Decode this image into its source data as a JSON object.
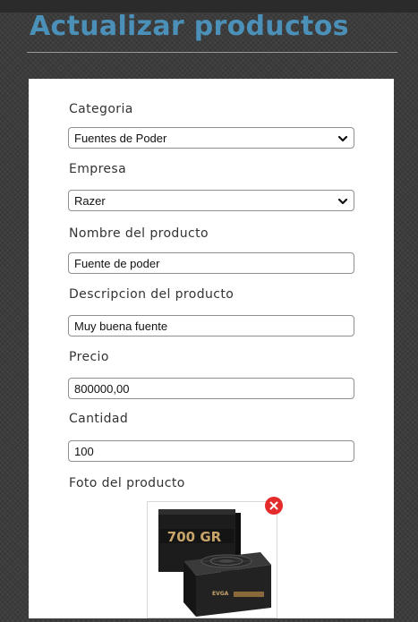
{
  "page": {
    "title": "Actualizar productos"
  },
  "form": {
    "category": {
      "label": "Categoria",
      "value": "Fuentes de Poder"
    },
    "company": {
      "label": "Empresa",
      "value": "Razer"
    },
    "name": {
      "label": "Nombre del producto",
      "value": "Fuente de poder"
    },
    "description": {
      "label": "Descripcion del producto",
      "value": "Muy buena fuente"
    },
    "price": {
      "label": "Precio",
      "value": "800000,00"
    },
    "quantity": {
      "label": "Cantidad",
      "value": "100"
    },
    "photo": {
      "label": "Foto del producto",
      "box_text": "700 GR",
      "brand_text": "EVGA"
    }
  },
  "colors": {
    "title": "#4a90b8",
    "remove": "#e32b2b"
  },
  "icons": {
    "select_arrow": "chevron-down-icon",
    "remove": "close-icon"
  }
}
